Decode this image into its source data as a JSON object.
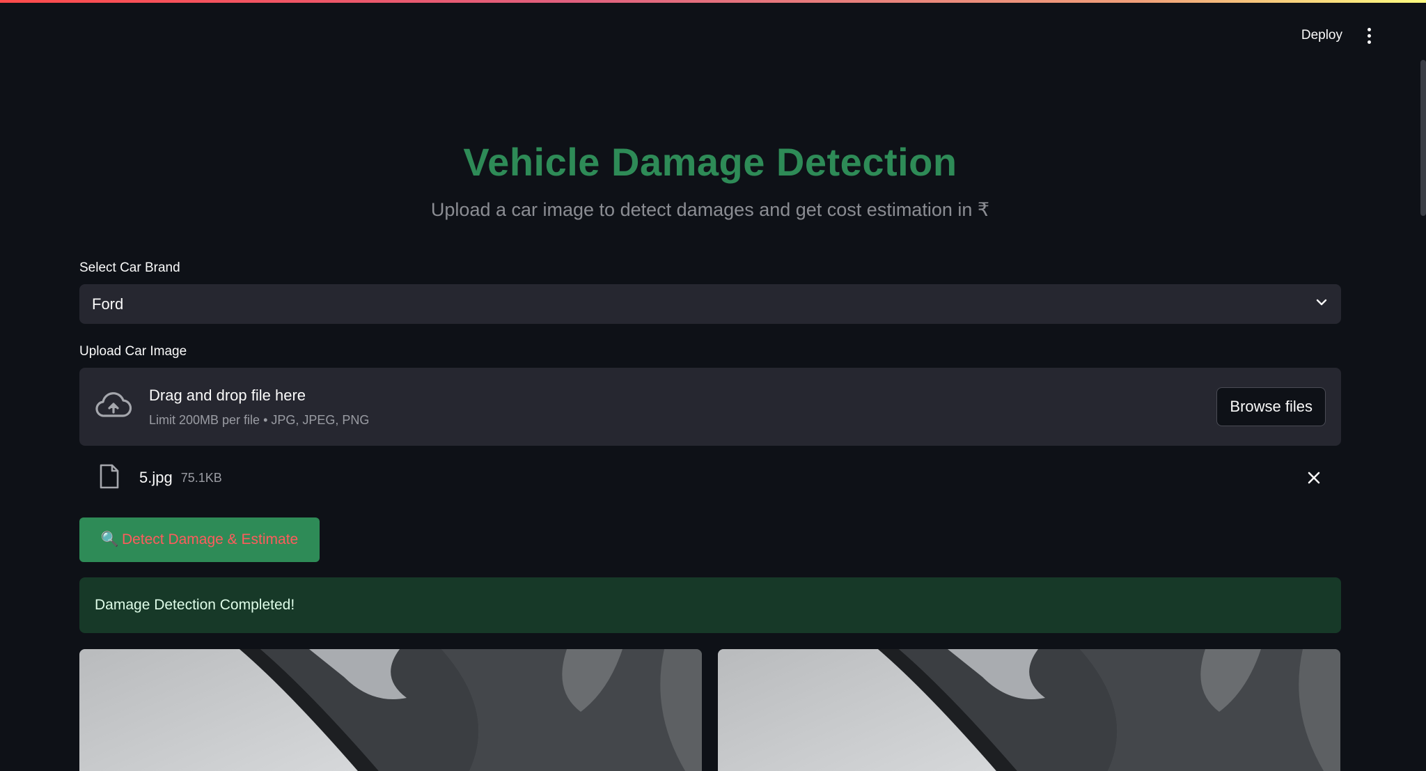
{
  "header": {
    "deploy_label": "Deploy",
    "menu_icon": "kebab-menu-icon"
  },
  "main": {
    "title": "Vehicle Damage Detection",
    "subtitle": "Upload a car image to detect damages and get cost estimation in ₹"
  },
  "brand_select": {
    "label": "Select Car Brand",
    "value": "Ford",
    "icon": "chevron-down-icon"
  },
  "uploader": {
    "label": "Upload Car Image",
    "dropzone_title": "Drag and drop file here",
    "dropzone_limit": "Limit 200MB per file • JPG, JPEG, PNG",
    "browse_label": "Browse files",
    "icon": "cloud-upload-icon"
  },
  "uploaded_file": {
    "name": "5.jpg",
    "size": "75.1KB",
    "icon": "file-icon",
    "remove_icon": "close-icon"
  },
  "detect_button": {
    "emoji": "🔍",
    "label": "Detect Damage & Estimate"
  },
  "status": {
    "message": "Damage Detection Completed!"
  },
  "colors": {
    "background": "#0e1117",
    "accent_green": "#2e8b57",
    "input_bg": "#262730",
    "success_bg": "#173928",
    "button_text": "#ff5c5c"
  }
}
